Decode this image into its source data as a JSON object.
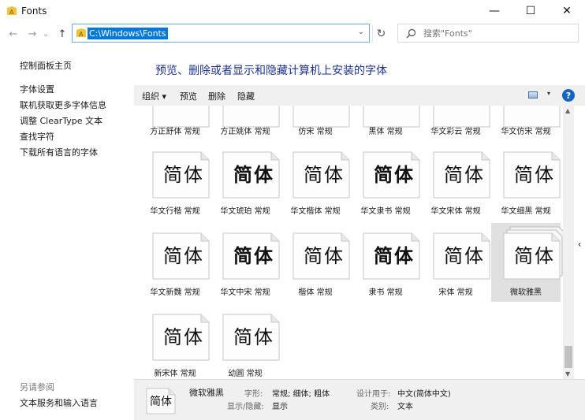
{
  "window": {
    "title": "Fonts",
    "minimize_glyph": "—",
    "maximize_glyph": "☐",
    "close_glyph": "✕"
  },
  "nav": {
    "back_glyph": "←",
    "forward_glyph": "→",
    "recent_glyph": "⌄",
    "up_glyph": "↑",
    "address": "C:\\Windows\\Fonts",
    "address_dropdown_glyph": "⌄",
    "refresh_glyph": "↻",
    "search_placeholder": "搜索\"Fonts\""
  },
  "sidebar": {
    "items": [
      {
        "label": "控制面板主页"
      },
      {
        "label": "字体设置"
      },
      {
        "label": "联机获取更多字体信息"
      },
      {
        "label": "调整 ClearType 文本"
      },
      {
        "label": "查找字符"
      },
      {
        "label": "下载所有语言的字体"
      }
    ],
    "see_also": "另请参阅",
    "see_also_items": [
      {
        "label": "文本服务和输入语言"
      }
    ]
  },
  "main": {
    "heading": "预览、删除或者显示和隐藏计算机上安装的字体",
    "toolbar": {
      "organize": "组织 ▾",
      "preview": "预览",
      "delete": "删除",
      "hide": "隐藏",
      "help": "?",
      "view_dropdown": "▾"
    },
    "preview_glyph": "简体",
    "fonts_top_row": [
      {
        "label": "方正舒体 常规"
      },
      {
        "label": "方正姚体 常规"
      },
      {
        "label": "仿宋 常规"
      },
      {
        "label": "黑体 常规"
      },
      {
        "label": "华文彩云 常规"
      },
      {
        "label": "华文仿宋 常规"
      }
    ],
    "fonts": [
      {
        "label": "华文行楷 常规"
      },
      {
        "label": "华文琥珀 常规"
      },
      {
        "label": "华文楷体 常规"
      },
      {
        "label": "华文隶书 常规"
      },
      {
        "label": "华文宋体 常规"
      },
      {
        "label": "华文细黑 常规"
      },
      {
        "label": "华文新魏 常规"
      },
      {
        "label": "华文中宋 常规"
      },
      {
        "label": "楷体 常规"
      },
      {
        "label": "隶书 常规"
      },
      {
        "label": "宋体 常规"
      },
      {
        "label": "微软雅黑",
        "selected": true
      },
      {
        "label": "新宋体 常规"
      },
      {
        "label": "幼圆 常规"
      }
    ]
  },
  "details": {
    "name": "微软雅黑",
    "style_label": "字形:",
    "style_value": "常规; 细体; 粗体",
    "show_hide_label": "显示/隐藏:",
    "show_hide_value": "显示",
    "designed_for_label": "设计用于:",
    "designed_for_value": "中文(简体中文)",
    "category_label": "类别:",
    "category_value": "文本"
  },
  "colors": {
    "accent": "#0078d7",
    "heading": "#1e3287",
    "selection": "#e0e0e0"
  }
}
